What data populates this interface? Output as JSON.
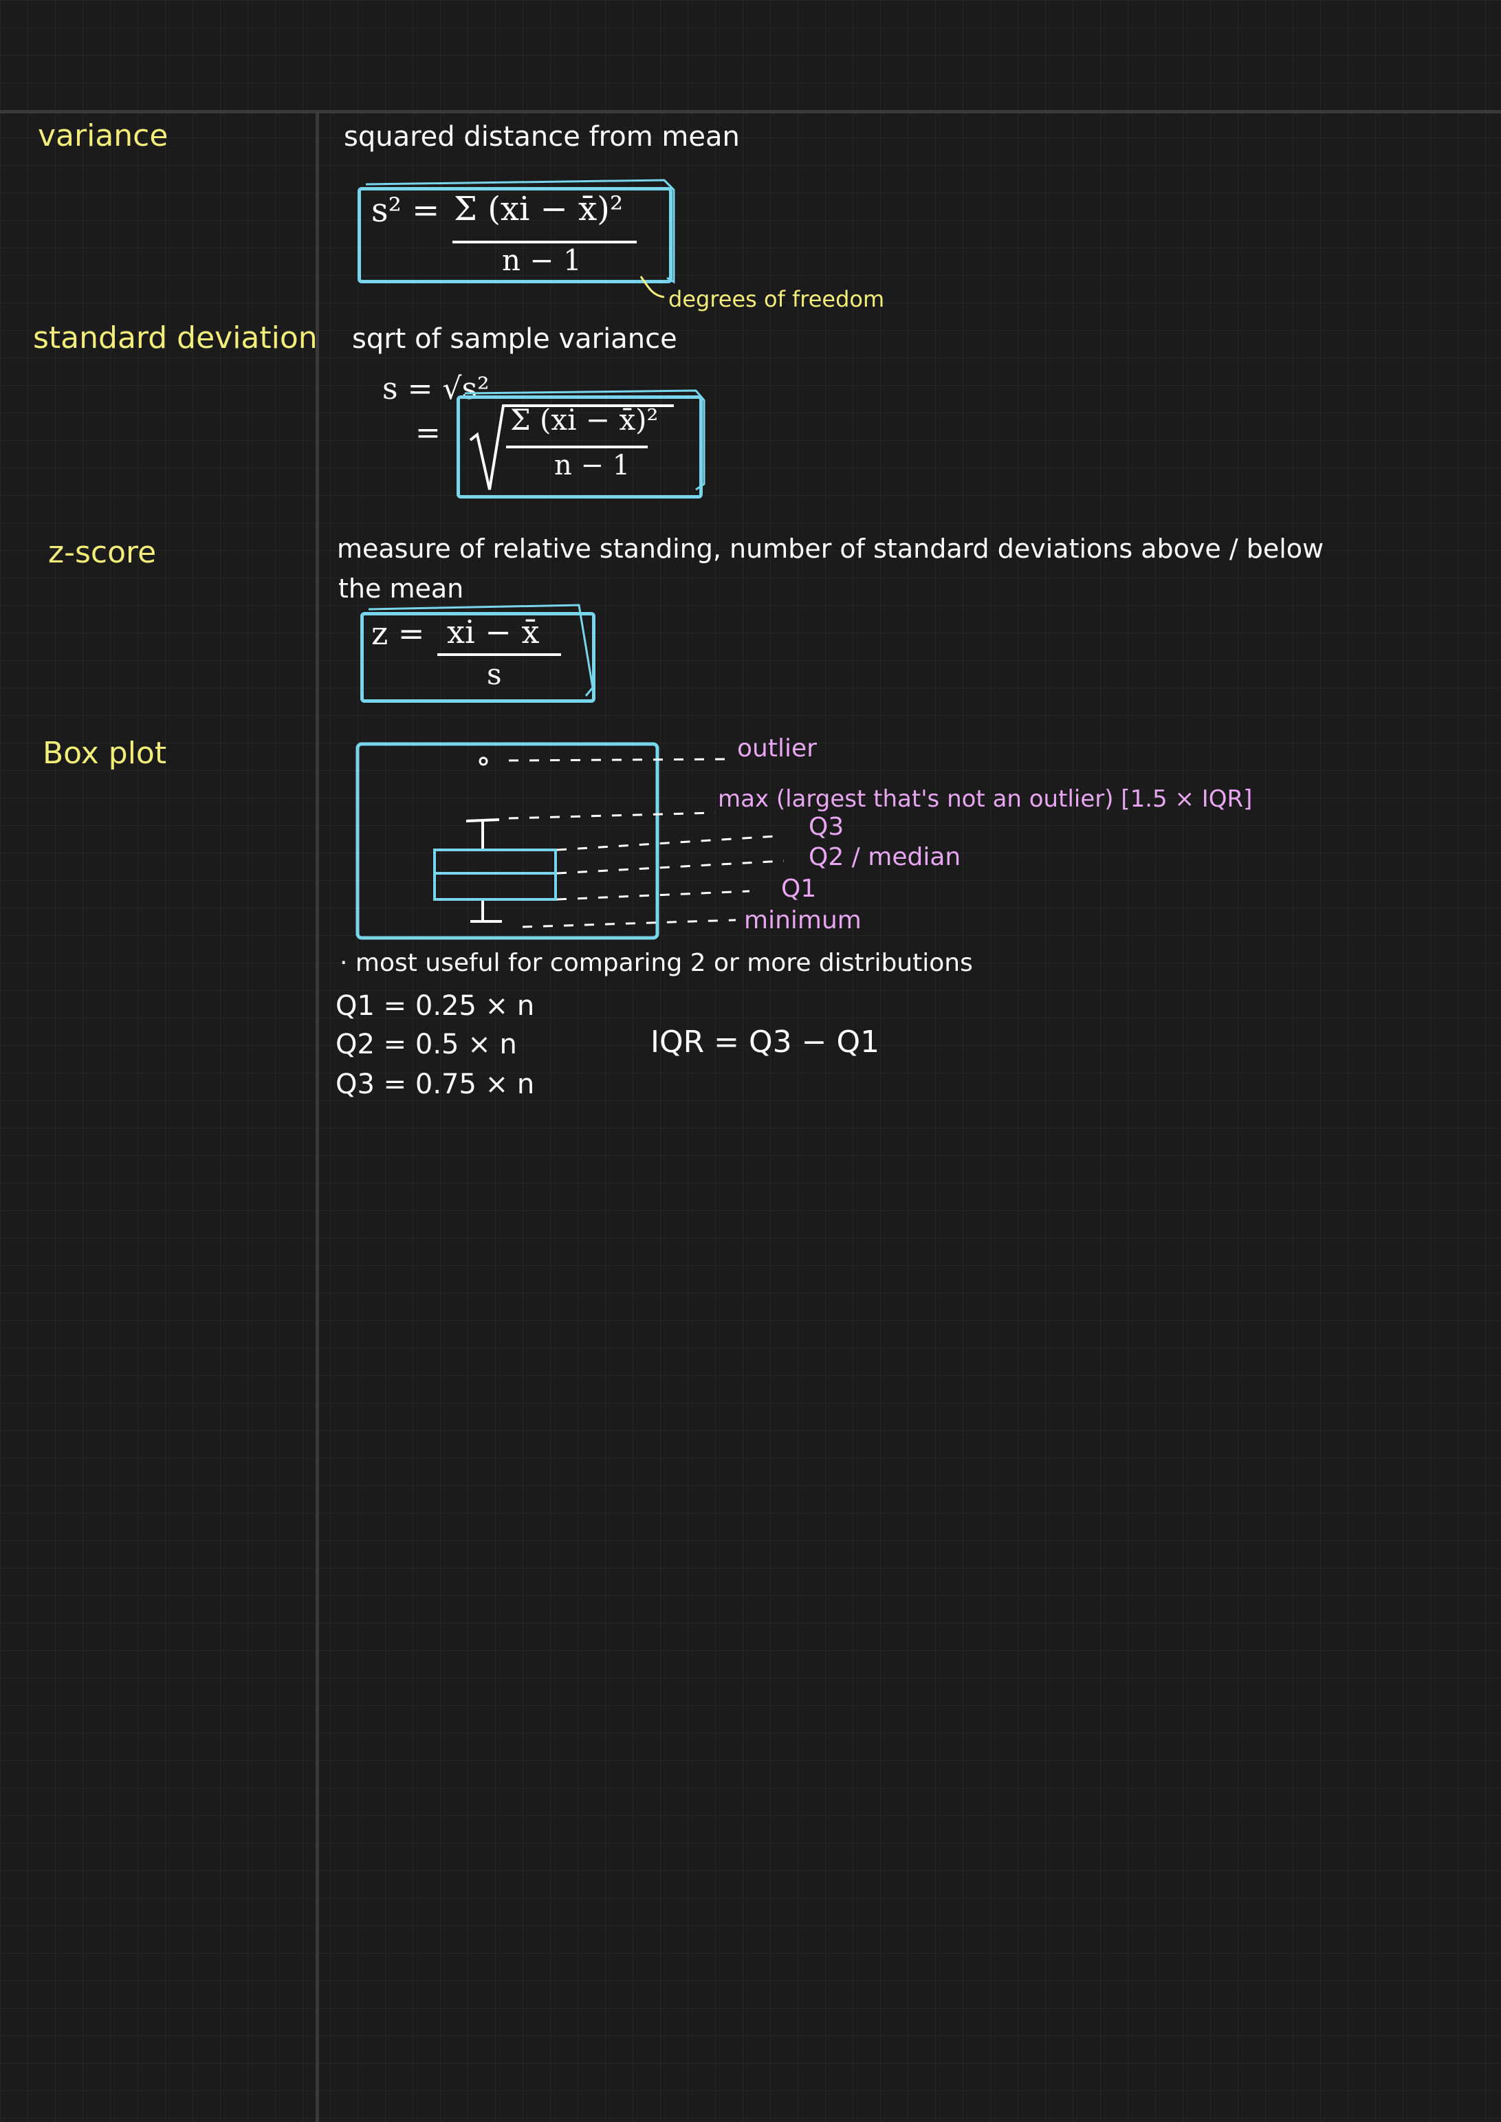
{
  "topics": {
    "variance": "variance",
    "standard_deviation": "standard deviation",
    "z_score": "z-score",
    "box_plot": "Box plot"
  },
  "variance": {
    "description": "squared distance from mean",
    "formula_lhs": "s² =",
    "formula_numerator": "Σ (xi − x̄)²",
    "formula_denominator": "n − 1",
    "annotation": "degrees of freedom"
  },
  "standard_deviation": {
    "description": "sqrt of sample variance",
    "formula_line1": "s = √s²",
    "formula_eq": "=",
    "formula_numerator": "Σ (xi − x̄)²",
    "formula_denominator": "n − 1"
  },
  "z_score": {
    "description_line1": "measure of relative standing, number of standard deviations above / below",
    "description_line2": "the mean",
    "formula_lhs": "z =",
    "formula_numerator": "xi − x̄",
    "formula_denominator": "s"
  },
  "box_plot": {
    "labels": {
      "outlier": "outlier",
      "max": "max (largest that's not an outlier) [1.5 × IQR]",
      "q3": "Q3",
      "q2": "Q2 / median",
      "q1": "Q1",
      "minimum": "minimum"
    },
    "note": "· most useful for comparing 2 or more distributions",
    "q1_formula": "Q1 = 0.25 × n",
    "q2_formula": "Q2 = 0.5 × n",
    "q3_formula": "Q3 =  0.75 × n",
    "iqr_formula": "IQR = Q3 − Q1"
  },
  "colors": {
    "background": "#1b1b1b",
    "grid": "#262626",
    "rule": "#3a3a3a",
    "topic_yellow": "#f3ee7a",
    "box_cyan": "#78d6ec",
    "label_pink": "#e9a6f2",
    "ink_white": "#ffffff"
  }
}
